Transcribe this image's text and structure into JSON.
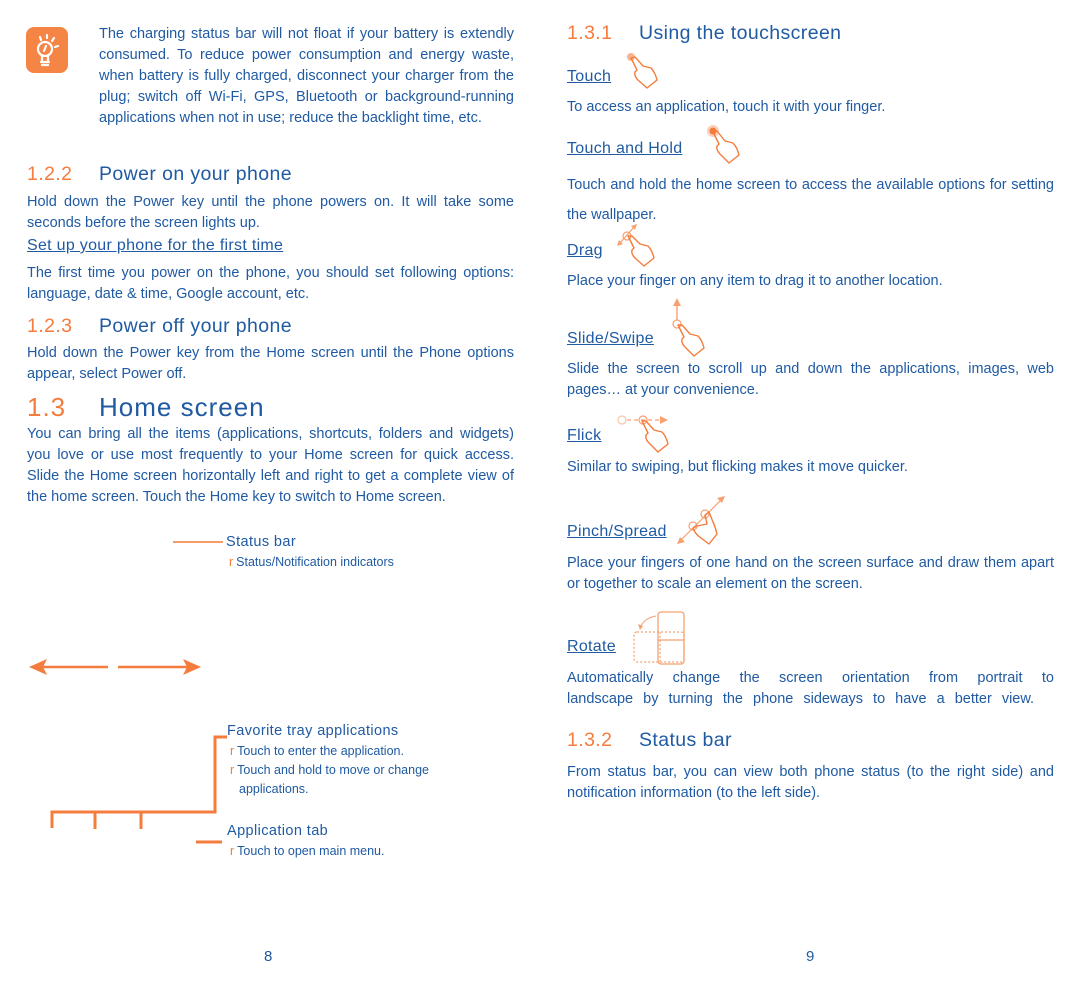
{
  "colors": {
    "text": "#1f5aa3",
    "accent": "#f47c3c",
    "icon_bg": "#f58545"
  },
  "left": {
    "tip": {
      "icon": "lightbulb-icon",
      "text": "The charging status bar will not float if your battery is extendly consumed. To reduce power consumption and energy waste, when battery is fully charged, disconnect your charger from the plug; switch off Wi-Fi, GPS, Bluetooth or background-running applications when not in use; reduce the backlight time, etc."
    },
    "s122": {
      "num": "1.2.2",
      "title": "Power on your phone",
      "body": "Hold down the Power key until the phone powers on. It will take some seconds before the screen lights up.",
      "subhead": "Set up your phone for the first time",
      "subbody": "The first time you power on the phone, you should set following options: language, date & time, Google account, etc."
    },
    "s123": {
      "num": "1.2.3",
      "title": "Power off your phone",
      "body": "Hold down the Power key from the Home screen until the Phone options appear, select Power off."
    },
    "s13": {
      "num": "1.3",
      "title": "Home screen",
      "body": "You can bring all the items (applications, shortcuts, folders and widgets) you love or use most frequently to your Home screen for quick access. Slide the Home screen horizontally left and right to get a complete view of the home screen. Touch the Home key to switch to Home screen."
    },
    "callouts": {
      "bullet": "r",
      "status_bar": {
        "title": "Status bar",
        "items": [
          "Status/Notification indicators"
        ]
      },
      "favorite_tray": {
        "title": "Favorite tray applications",
        "items": [
          "Touch to enter the application.",
          "Touch and hold to move or change applications."
        ]
      },
      "app_tab": {
        "title": "Application tab",
        "items": [
          "Touch to open main menu."
        ]
      }
    },
    "page_number": "8"
  },
  "right": {
    "s131": {
      "num": "1.3.1",
      "title": "Using the touchscreen",
      "gestures": [
        {
          "label": "Touch",
          "icon": "touch-gesture-icon",
          "desc": "To access an application, touch it with your finger."
        },
        {
          "label": "Touch and Hold",
          "icon": "touch-hold-gesture-icon",
          "desc": "Touch and hold the home screen to access the available options for setting the wallpaper."
        },
        {
          "label": "Drag",
          "icon": "drag-gesture-icon",
          "desc": "Place your finger on any item to drag it to another location."
        },
        {
          "label": "Slide/Swipe",
          "icon": "swipe-gesture-icon",
          "desc": "Slide the screen to scroll up and down the applications, images, web pages… at your convenience."
        },
        {
          "label": "Flick",
          "icon": "flick-gesture-icon",
          "desc": "Similar to swiping, but flicking makes it move quicker."
        },
        {
          "label": "Pinch/Spread",
          "icon": "pinch-gesture-icon",
          "desc": "Place your fingers of one hand on the screen surface and draw them apart or together to scale an element on the screen."
        },
        {
          "label": "Rotate",
          "icon": "rotate-gesture-icon",
          "desc": "Automatically change the screen orientation from portrait to landscape by turning the phone sideways to have a better view."
        }
      ]
    },
    "s132": {
      "num": "1.3.2",
      "title": "Status bar",
      "body": "From status bar, you can view both phone status (to the right side) and notification information (to the left side)."
    },
    "page_number": "9"
  }
}
